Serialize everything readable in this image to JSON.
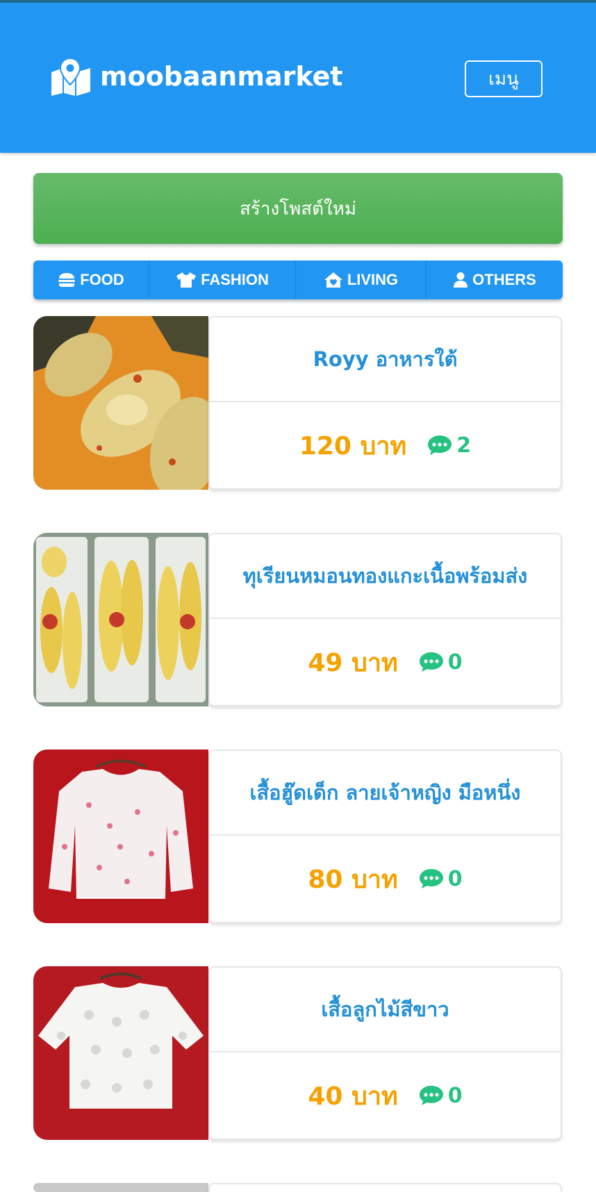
{
  "header": {
    "brand": "moobaanmarket",
    "menu_label": "เมนู"
  },
  "actions": {
    "create_post": "สร้างโพสต์ใหม่"
  },
  "categories": [
    {
      "label": "FOOD",
      "icon": "burger-icon"
    },
    {
      "label": "FASHION",
      "icon": "shirt-icon"
    },
    {
      "label": "LIVING",
      "icon": "home-heart-icon"
    },
    {
      "label": "OTHERS",
      "icon": "user-icon"
    }
  ],
  "listings": [
    {
      "title": "Royy อาหารใต้",
      "price": "120 บาท",
      "comments": "2",
      "image": "fish-curry"
    },
    {
      "title": "ทุเรียนหมอนทองแกะเนื้อพร้อมส่ง",
      "price": "49 บาท",
      "comments": "0",
      "image": "durian-boxes"
    },
    {
      "title": "เสื้อฮู๊ดเด็ก ลายเจ้าหญิง มือหนึ่ง",
      "price": "80 บาท",
      "comments": "0",
      "image": "floral-blouse"
    },
    {
      "title": "เสื้อลูกไม้สีขาว",
      "price": "40 บาท",
      "comments": "0",
      "image": "white-lace-top"
    }
  ],
  "colors": {
    "header": "#2196f3",
    "create_post": "#4caf50",
    "title": "#2490d8",
    "price": "#f5a200",
    "comment": "#26c281"
  }
}
